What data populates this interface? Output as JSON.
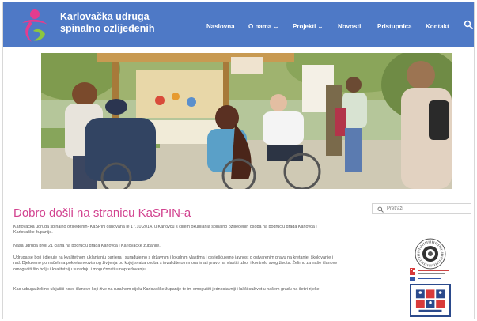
{
  "site": {
    "title_line1": "Karlovačka udruga",
    "title_line2": "spinalno ozlijeđenih"
  },
  "nav": {
    "items": [
      "Naslovna",
      "O nama",
      "Projekti",
      "Novosti",
      "Pristupnica",
      "Kontakt"
    ]
  },
  "main": {
    "heading": "Dobro došli na stranicu KaSPIN-a",
    "paragraphs": [
      "Karlovačka udruga spinalno ozlijeđenih- KaSPIN osnovana je 17.10.2014. u Karlovcu s ciljem okupljanja spinalno ozlijeđenih osoba na području grada Karlovca i Karlovačke županije.",
      "Naša udruga broji 21 člana na području grada Karlovca i Karlovačke županije.",
      "Udruga se bori i djeluje na kvalitetnom uklanjanju barijera i surađujemo s državnim i lokalnim vlastima i osvješćujemo javnost o ostvarenim pravu na kretanje, školovanje i rad. Djelujemo po načelima pokreta neovisnog življenja po kojoj svaka osoba s invaliditetom mora imati pravo na vlastiti izbor i kontrolu svog života. Želimo za naše članove omogućiti što bolju i kvalitetniju suradnju i mogućnosti u napredovanju.",
      "Kao udruga želimo uključiti nove članove koji žive na ruralnom dijelu Karlovačke županije te im omogućiti jednostavniji i lakši suživot u našem gradu na četiri rijeke."
    ]
  },
  "sidebar": {
    "search_placeholder": "Pretraži"
  },
  "colors": {
    "header": "#4e79c6",
    "heading": "#d2428f"
  }
}
